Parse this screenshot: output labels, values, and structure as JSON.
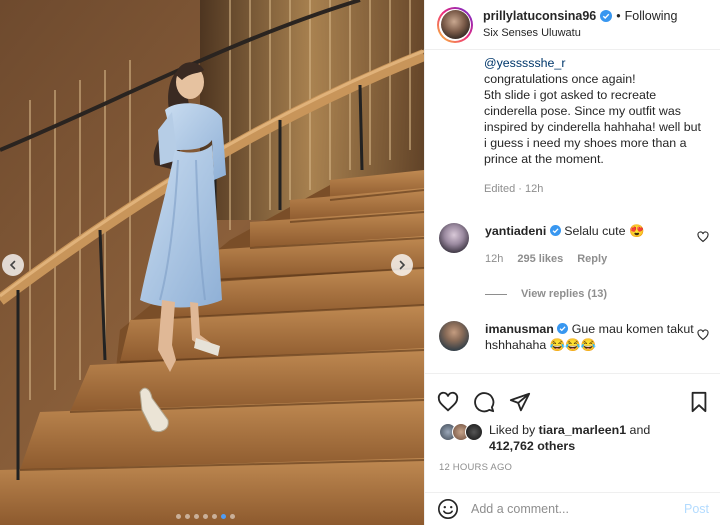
{
  "post": {
    "username": "prillylatuconsina96",
    "follow_status": "Following",
    "location": "Six Senses Uluwatu",
    "caption_tag": "@yessssshe_r",
    "caption_lines": [
      "congratulations once again!",
      "5th slide i got asked to recreate cinderella pose. Since my outfit was inspired by cinderella hahhaha! well but i guess i need my shoes more than a prince at the moment."
    ],
    "edited": "Edited · 12h"
  },
  "comments": [
    {
      "username": "yantiadeni",
      "text": "Selalu cute 😍",
      "time": "12h",
      "likes": "295 likes",
      "reply_label": "Reply",
      "view_replies": "View replies (13)"
    },
    {
      "username": "imanusman",
      "text": "Gue mau komen takut hshhahaha 😂😂😂"
    }
  ],
  "likes": {
    "prefix": "Liked by",
    "user": "tiara_marleen1",
    "conj": "and",
    "others": "412,762 others"
  },
  "timestamp": "12 HOURS AGO",
  "composer": {
    "placeholder": "Add a comment...",
    "post_label": "Post"
  },
  "carousel": {
    "slide_count": 7,
    "active_index": 5
  },
  "colors": {
    "verified": "#3897f0",
    "link": "#00376b",
    "muted": "#8e8e8e",
    "post_disabled": "#b3dbff"
  }
}
